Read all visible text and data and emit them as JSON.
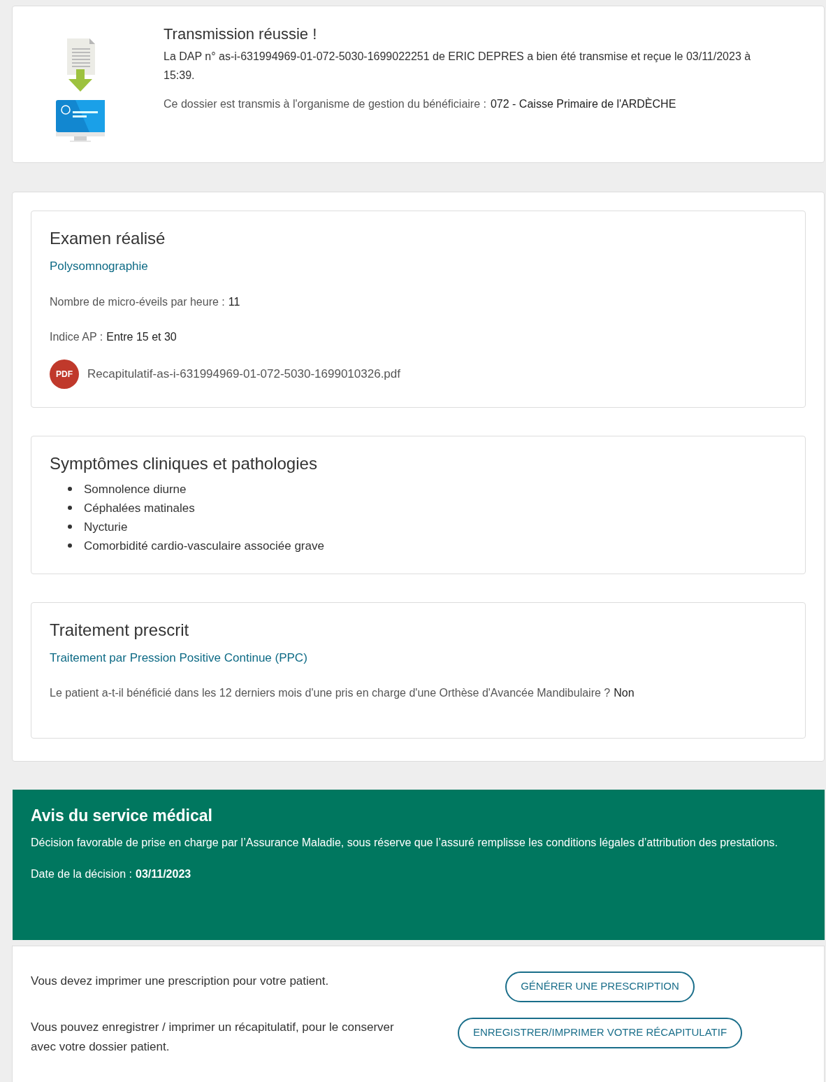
{
  "confirmation": {
    "title": "Transmission réussie !",
    "message": "La DAP n° as-i-631994969-01-072-5030-1699022251 de ERIC DEPRES a bien été transmise et reçue le 03/11/2023 à 15:39.",
    "organism_label": "Ce dossier est transmis à l'organisme de gestion du bénéficiaire :",
    "organism_value": "072 - Caisse Primaire de l'ARDÈCHE"
  },
  "sections": [
    {
      "kind": "exam",
      "title": "Examen réalisé",
      "subtitle": "Polysomnographie",
      "fields": [
        {
          "label": "Nombre de micro-éveils par heure :",
          "value": "11"
        },
        {
          "label": "Indice AP :",
          "value": "Entre 15 et 30"
        }
      ],
      "file": {
        "icon": "PDF",
        "name": "Recapitulatif-as-i-631994969-01-072-5030-1699010326.pdf"
      }
    },
    {
      "kind": "list",
      "title": "Symptômes cliniques et pathologies",
      "items": [
        "Somnolence diurne",
        "Céphalées matinales",
        "Nycturie",
        "Comorbidité cardio-vasculaire associée grave"
      ]
    },
    {
      "kind": "exam",
      "title": "Traitement prescrit",
      "subtitle": "Traitement par Pression Positive Continue (PPC)",
      "fields": [
        {
          "label": "Le patient a-t-il bénéficié dans les 12 derniers mois d'une pris en charge d'une Orthèse d'Avancée Mandibulaire ?",
          "value": "Non"
        }
      ]
    }
  ],
  "medical_opinion": {
    "title": "Avis du service médical",
    "text": "Décision favorable de prise en charge par l’Assurance Maladie, sous réserve que l’assuré remplisse les conditions légales d’attribution des prestations.",
    "date_label": "Date de la décision :",
    "date_value": "03/11/2023"
  },
  "actions": [
    {
      "text": "Vous devez imprimer une prescription pour votre patient.",
      "button": "GÉNÉRER UNE PRESCRIPTION"
    },
    {
      "text": "Vous pouvez enregistrer / imprimer un récapitulatif, pour le conserver avec votre dossier patient.",
      "button": "ENREGISTRER/IMPRIMER VOTRE RÉCAPITULATIF"
    }
  ]
}
